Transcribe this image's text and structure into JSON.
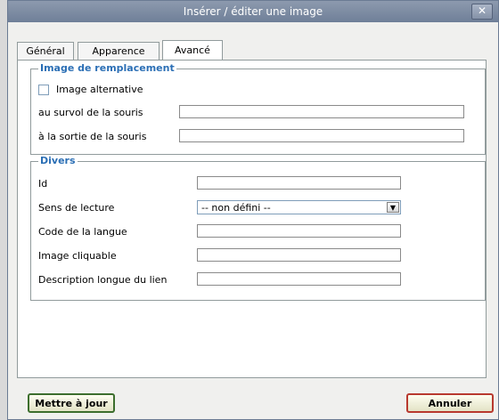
{
  "dialog": {
    "title": "Insérer / éditer une image",
    "close_icon": "close-icon"
  },
  "tabs": [
    {
      "label": "Général"
    },
    {
      "label": "Apparence"
    },
    {
      "label": "Avancé"
    }
  ],
  "replacement_group": {
    "legend": "Image de remplacement",
    "alt_image_label": "Image alternative",
    "mouseover_label": "au survol de la souris",
    "mouseout_label": "à la sortie de la souris"
  },
  "misc_group": {
    "legend": "Divers",
    "id_label": "Id",
    "direction_label": "Sens de lecture",
    "direction_value": "-- non défini --",
    "lang_label": "Code de la langue",
    "map_label": "Image cliquable",
    "longdesc_label": "Description longue du lien"
  },
  "buttons": {
    "update": "Mettre à jour",
    "cancel": "Annuler"
  }
}
